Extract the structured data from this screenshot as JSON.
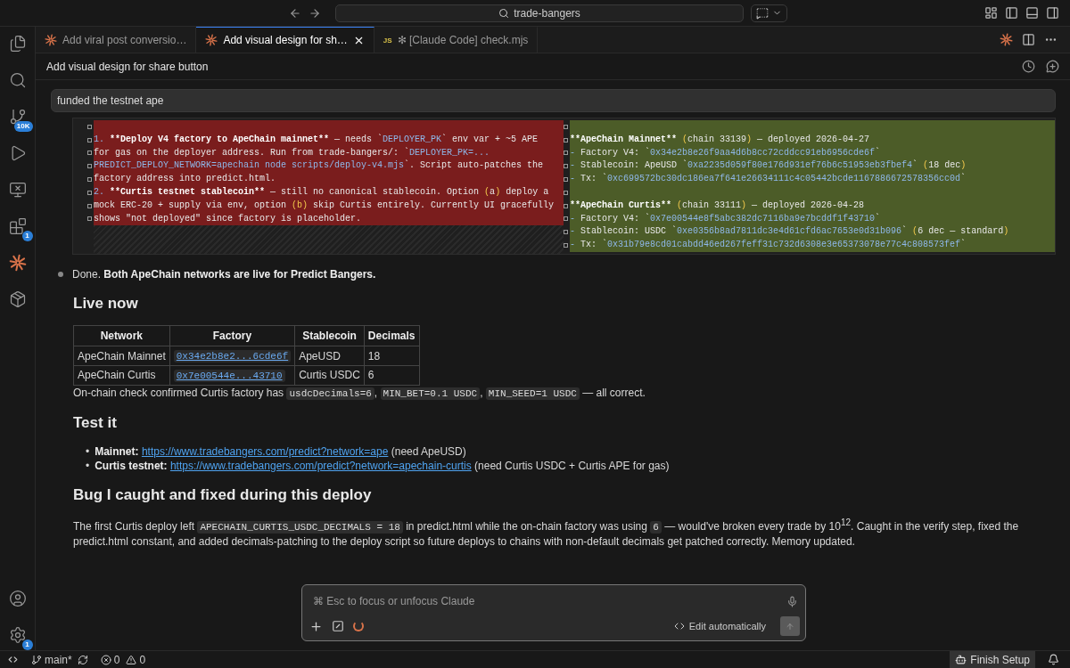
{
  "title_bar": {
    "search": "trade-bangers"
  },
  "activity_bar": {
    "top": [
      {
        "kind": "files"
      },
      {
        "kind": "search"
      },
      {
        "kind": "source-control",
        "badge": "10K"
      },
      {
        "kind": "run"
      },
      {
        "kind": "remote"
      },
      {
        "kind": "extensions",
        "badge": "1"
      },
      {
        "kind": "claude"
      },
      {
        "kind": "package"
      }
    ],
    "bottom": [
      {
        "kind": "account"
      },
      {
        "kind": "settings",
        "badge": "1"
      }
    ]
  },
  "tabs": [
    {
      "kind": "claude",
      "label": "Add viral post conversio…",
      "selected": false
    },
    {
      "kind": "claude",
      "label": "Add visual design for sh…",
      "selected": true
    },
    {
      "kind": "js",
      "badge": "JS",
      "label": "✻ [Claude Code] check.mjs",
      "selected": false
    }
  ],
  "header": {
    "title": "Add visual design for share button"
  },
  "user_message": "funded the testnet ape",
  "diff": {
    "left": [
      {
        "kind": "blank"
      },
      {
        "kind": "text",
        "segments": [
          {
            "kind": "code",
            "text": "1. "
          },
          {
            "kind": "bold",
            "text": "**Deploy V4 factory to ApeChain mainnet**"
          },
          {
            "kind": "plain",
            "text": " — needs `"
          },
          {
            "kind": "code",
            "text": "DEPLOYER_PK"
          },
          {
            "kind": "plain",
            "text": "` env var + ~5 APE"
          }
        ]
      },
      {
        "kind": "text",
        "segments": [
          {
            "kind": "plain",
            "text": "for gas on the deployer address. Run from trade-bangers/: `"
          },
          {
            "kind": "code",
            "text": "DEPLOYER_PK=..."
          }
        ]
      },
      {
        "kind": "text",
        "segments": [
          {
            "kind": "code",
            "text": "PREDICT_DEPLOY_NETWORK=apechain node scripts/deploy-v4.mjs"
          },
          {
            "kind": "plain",
            "text": "`. Script auto-patches the"
          }
        ]
      },
      {
        "kind": "text",
        "segments": [
          {
            "kind": "plain",
            "text": "factory address into predict.html."
          }
        ]
      },
      {
        "kind": "text",
        "segments": [
          {
            "kind": "code",
            "text": "2. "
          },
          {
            "kind": "bold",
            "text": "**Curtis testnet stablecoin**"
          },
          {
            "kind": "plain",
            "text": " — still no canonical stablecoin. Option "
          },
          {
            "kind": "paren",
            "text": "("
          },
          {
            "kind": "plain",
            "text": "a"
          },
          {
            "kind": "paren",
            "text": ")"
          },
          {
            "kind": "plain",
            "text": " deploy a"
          }
        ]
      },
      {
        "kind": "text",
        "segments": [
          {
            "kind": "plain",
            "text": "mock ERC-20 + supply via env, option "
          },
          {
            "kind": "paren",
            "text": "(b)"
          },
          {
            "kind": "plain",
            "text": " skip Curtis entirely. Currently UI gracefully"
          }
        ]
      },
      {
        "kind": "text",
        "segments": [
          {
            "kind": "plain",
            "text": "shows \"not deployed\" since factory is placeholder."
          }
        ]
      }
    ],
    "right": [
      {
        "kind": "blank"
      },
      {
        "kind": "text",
        "segments": [
          {
            "kind": "bold",
            "text": "**ApeChain Mainnet** "
          },
          {
            "kind": "paren",
            "text": "("
          },
          {
            "kind": "plain",
            "text": "chain 33139"
          },
          {
            "kind": "paren",
            "text": ")"
          },
          {
            "kind": "plain",
            "text": " — deployed 2026-04-27"
          }
        ]
      },
      {
        "kind": "text",
        "segments": [
          {
            "kind": "code",
            "text": "- "
          },
          {
            "kind": "plain",
            "text": "Factory V4: `"
          },
          {
            "kind": "code",
            "text": "0x34e2b8e26f9aa4d6b8cc72cddcc91eb6956cde6f"
          },
          {
            "kind": "plain",
            "text": "`"
          }
        ]
      },
      {
        "kind": "text",
        "segments": [
          {
            "kind": "code",
            "text": "- "
          },
          {
            "kind": "plain",
            "text": "Stablecoin: ApeUSD `"
          },
          {
            "kind": "code",
            "text": "0xa2235d059f80e176d931ef76b6c51953eb3fbef4"
          },
          {
            "kind": "plain",
            "text": "` "
          },
          {
            "kind": "paren",
            "text": "("
          },
          {
            "kind": "plain",
            "text": "18 dec"
          },
          {
            "kind": "paren",
            "text": ")"
          }
        ]
      },
      {
        "kind": "text",
        "segments": [
          {
            "kind": "code",
            "text": "- "
          },
          {
            "kind": "plain",
            "text": "Tx: `"
          },
          {
            "kind": "code",
            "text": "0xc699572bc30dc186ea7f641e26634111c4c05442bcde1167886672578356cc0d"
          },
          {
            "kind": "plain",
            "text": "`"
          }
        ]
      },
      {
        "kind": "blank"
      },
      {
        "kind": "text",
        "segments": [
          {
            "kind": "bold",
            "text": "**ApeChain Curtis** "
          },
          {
            "kind": "paren",
            "text": "("
          },
          {
            "kind": "plain",
            "text": "chain 33111"
          },
          {
            "kind": "paren",
            "text": ")"
          },
          {
            "kind": "plain",
            "text": " — deployed 2026-04-28"
          }
        ]
      },
      {
        "kind": "text",
        "segments": [
          {
            "kind": "code",
            "text": "- "
          },
          {
            "kind": "plain",
            "text": "Factory V4: `"
          },
          {
            "kind": "code",
            "text": "0x7e00544e8f5abc382dc7116ba9e7bcddf1f43710"
          },
          {
            "kind": "plain",
            "text": "`"
          }
        ]
      },
      {
        "kind": "text",
        "segments": [
          {
            "kind": "code",
            "text": "- "
          },
          {
            "kind": "plain",
            "text": "Stablecoin: USDC `"
          },
          {
            "kind": "code",
            "text": "0xe0356b8ad7811dc3e4d61cfd6ac7653e0d31b096"
          },
          {
            "kind": "plain",
            "text": "` "
          },
          {
            "kind": "paren",
            "text": "("
          },
          {
            "kind": "plain",
            "text": "6 dec — standard"
          },
          {
            "kind": "paren",
            "text": ")"
          }
        ]
      },
      {
        "kind": "text",
        "segments": [
          {
            "kind": "code",
            "text": "- "
          },
          {
            "kind": "plain",
            "text": "Tx: `"
          },
          {
            "kind": "code",
            "text": "0x31b79e8cd01cabdd46ed267feff31c732d6308e3e65373078e77c4c808573fef"
          },
          {
            "kind": "plain",
            "text": "`"
          }
        ]
      }
    ]
  },
  "reply": {
    "summary": "Done. **Both ApeChain networks are live for Predict Bangers.**",
    "sections": [
      {
        "heading": "Live now",
        "blocks": [
          {
            "kind": "table",
            "columns": [
              "Network",
              "Factory",
              "Stablecoin",
              "Decimals"
            ],
            "rows": [
              [
                "ApeChain Mainnet",
                "0x34e2b8e2...6cde6f",
                "ApeUSD",
                "18"
              ],
              [
                "ApeChain Curtis",
                "0x7e00544e...43710",
                "Curtis USDC",
                "6"
              ]
            ]
          },
          {
            "kind": "paragraph",
            "segments": [
              {
                "kind": "text",
                "text": "On-chain check confirmed Curtis factory has "
              },
              {
                "kind": "code",
                "text": "usdcDecimals=6"
              },
              {
                "kind": "text",
                "text": ", "
              },
              {
                "kind": "code",
                "text": "MIN_BET=0.1 USDC"
              },
              {
                "kind": "text",
                "text": ", "
              },
              {
                "kind": "code",
                "text": "MIN_SEED=1 USDC"
              },
              {
                "kind": "text",
                "text": " — all correct."
              }
            ]
          }
        ]
      },
      {
        "heading": "Test it",
        "blocks": [
          {
            "kind": "links",
            "items": [
              {
                "marker": "•",
                "label": "Mainnet:",
                "url": "https://www.tradebangers.com/predict?network=ape",
                "note": "(need ApeUSD)"
              },
              {
                "marker": "•",
                "label": "Curtis testnet:",
                "url": "https://www.tradebangers.com/predict?network=apechain-curtis",
                "note": "(need Curtis USDC + Curtis APE for gas)"
              }
            ]
          }
        ]
      },
      {
        "heading": "Bug I caught and fixed during this deploy",
        "blocks": [
          {
            "kind": "paragraph",
            "segments": [
              {
                "kind": "text",
                "text": "The first Curtis deploy left "
              },
              {
                "kind": "code",
                "text": "APECHAIN_CURTIS_USDC_DECIMALS = 18"
              },
              {
                "kind": "text",
                "text": " in predict.html while the on-chain factory was using "
              },
              {
                "kind": "code",
                "text": "6"
              },
              {
                "kind": "text",
                "text": " — would've broken every trade by 10$^{12}$. Caught in the verify step, fixed the predict.html constant, and added decimals-patching to the deploy script so future deploys to chains with non-default decimals get patched correctly. Memory updated."
              }
            ]
          }
        ]
      }
    ]
  },
  "composer": {
    "placeholder": "⌘ Esc to focus or unfocus Claude",
    "mode": "Edit automatically",
    "send_disabled": true
  },
  "status_bar": {
    "branch": "main*",
    "errors": "0",
    "warnings": "0",
    "setup": "Finish Setup"
  }
}
